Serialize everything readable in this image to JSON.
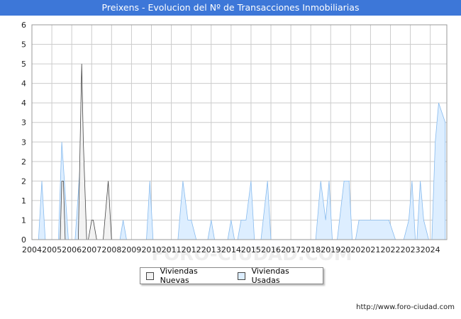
{
  "title": "Preixens - Evolucion del Nº de Transacciones Inmobiliarias",
  "footer": "http://www.foro-ciudad.com",
  "watermark": "FORO-CIUDAD.COM",
  "colors": {
    "title_bg": "#3d77d8",
    "nuevas_fill": "#f2f2f2",
    "nuevas_stroke": "#444444",
    "usadas_fill": "#ddeeff",
    "usadas_stroke": "#88bbee",
    "grid": "#cccccc"
  },
  "legend": {
    "nuevas": "Viviendas Nuevas",
    "usadas": "Viviendas Usadas"
  },
  "chart_data": {
    "type": "area",
    "title": "Preixens - Evolucion del Nº de Transacciones Inmobiliarias",
    "y_ticks": [
      "0",
      "1",
      "1",
      "2",
      "2",
      "3",
      "3",
      "4",
      "4",
      "5",
      "5",
      "6"
    ],
    "ylim": [
      0,
      5.5
    ],
    "x_ticks": [
      "2004",
      "2005",
      "2006",
      "2007",
      "2008",
      "2009",
      "2010",
      "2011",
      "2012",
      "2013",
      "2014",
      "2015",
      "2016",
      "2017",
      "2018",
      "2019",
      "2020",
      "2021",
      "2022",
      "2023",
      "2024"
    ],
    "xlim": [
      2004,
      2024.83
    ],
    "grid": true,
    "legend_position": "bottom",
    "series": [
      {
        "name": "Viviendas Nuevas",
        "points": [
          [
            2005.42,
            0
          ],
          [
            2005.5,
            1.5
          ],
          [
            2005.58,
            1.5
          ],
          [
            2005.67,
            0
          ],
          [
            2006.33,
            0
          ],
          [
            2006.42,
            2.5
          ],
          [
            2006.5,
            4.5
          ],
          [
            2006.58,
            2.5
          ],
          [
            2006.75,
            0
          ],
          [
            2006.83,
            0
          ],
          [
            2007.0,
            0.5
          ],
          [
            2007.08,
            0.5
          ],
          [
            2007.25,
            0
          ],
          [
            2007.58,
            0
          ],
          [
            2007.83,
            1.5
          ],
          [
            2008.0,
            0
          ]
        ]
      },
      {
        "name": "Viviendas Usadas",
        "points": [
          [
            2004.33,
            0
          ],
          [
            2004.5,
            1.5
          ],
          [
            2004.67,
            0
          ],
          [
            2005.33,
            0
          ],
          [
            2005.5,
            2.5
          ],
          [
            2005.83,
            0
          ],
          [
            2006.17,
            0
          ],
          [
            2006.5,
            2.5
          ],
          [
            2006.75,
            0
          ],
          [
            2008.42,
            0
          ],
          [
            2008.58,
            0.5
          ],
          [
            2008.75,
            0
          ],
          [
            2009.75,
            0
          ],
          [
            2009.92,
            1.5
          ],
          [
            2010.08,
            0
          ],
          [
            2011.33,
            0
          ],
          [
            2011.58,
            1.5
          ],
          [
            2011.83,
            0.5
          ],
          [
            2012.0,
            0.5
          ],
          [
            2012.25,
            0
          ],
          [
            2012.83,
            0
          ],
          [
            2013.0,
            0.5
          ],
          [
            2013.17,
            0
          ],
          [
            2013.83,
            0
          ],
          [
            2014.0,
            0.5
          ],
          [
            2014.17,
            0
          ],
          [
            2014.33,
            0
          ],
          [
            2014.5,
            0.5
          ],
          [
            2014.75,
            0.5
          ],
          [
            2015.0,
            1.5
          ],
          [
            2015.17,
            0
          ],
          [
            2015.5,
            0
          ],
          [
            2015.83,
            1.5
          ],
          [
            2016.0,
            0
          ],
          [
            2018.25,
            0
          ],
          [
            2018.5,
            1.5
          ],
          [
            2018.75,
            0.5
          ],
          [
            2018.92,
            1.5
          ],
          [
            2019.08,
            0
          ],
          [
            2019.33,
            0
          ],
          [
            2019.67,
            1.5
          ],
          [
            2019.92,
            1.5
          ],
          [
            2020.08,
            0
          ],
          [
            2020.25,
            0
          ],
          [
            2020.42,
            0.5
          ],
          [
            2021.92,
            0.5
          ],
          [
            2022.25,
            0
          ],
          [
            2022.67,
            0
          ],
          [
            2022.92,
            0.5
          ],
          [
            2023.08,
            1.5
          ],
          [
            2023.25,
            0
          ],
          [
            2023.33,
            0
          ],
          [
            2023.5,
            1.5
          ],
          [
            2023.67,
            0.5
          ],
          [
            2023.92,
            0
          ],
          [
            2024.08,
            0
          ],
          [
            2024.25,
            2.5
          ],
          [
            2024.42,
            3.5
          ],
          [
            2024.75,
            3
          ],
          [
            2024.75,
            0
          ]
        ]
      }
    ]
  }
}
